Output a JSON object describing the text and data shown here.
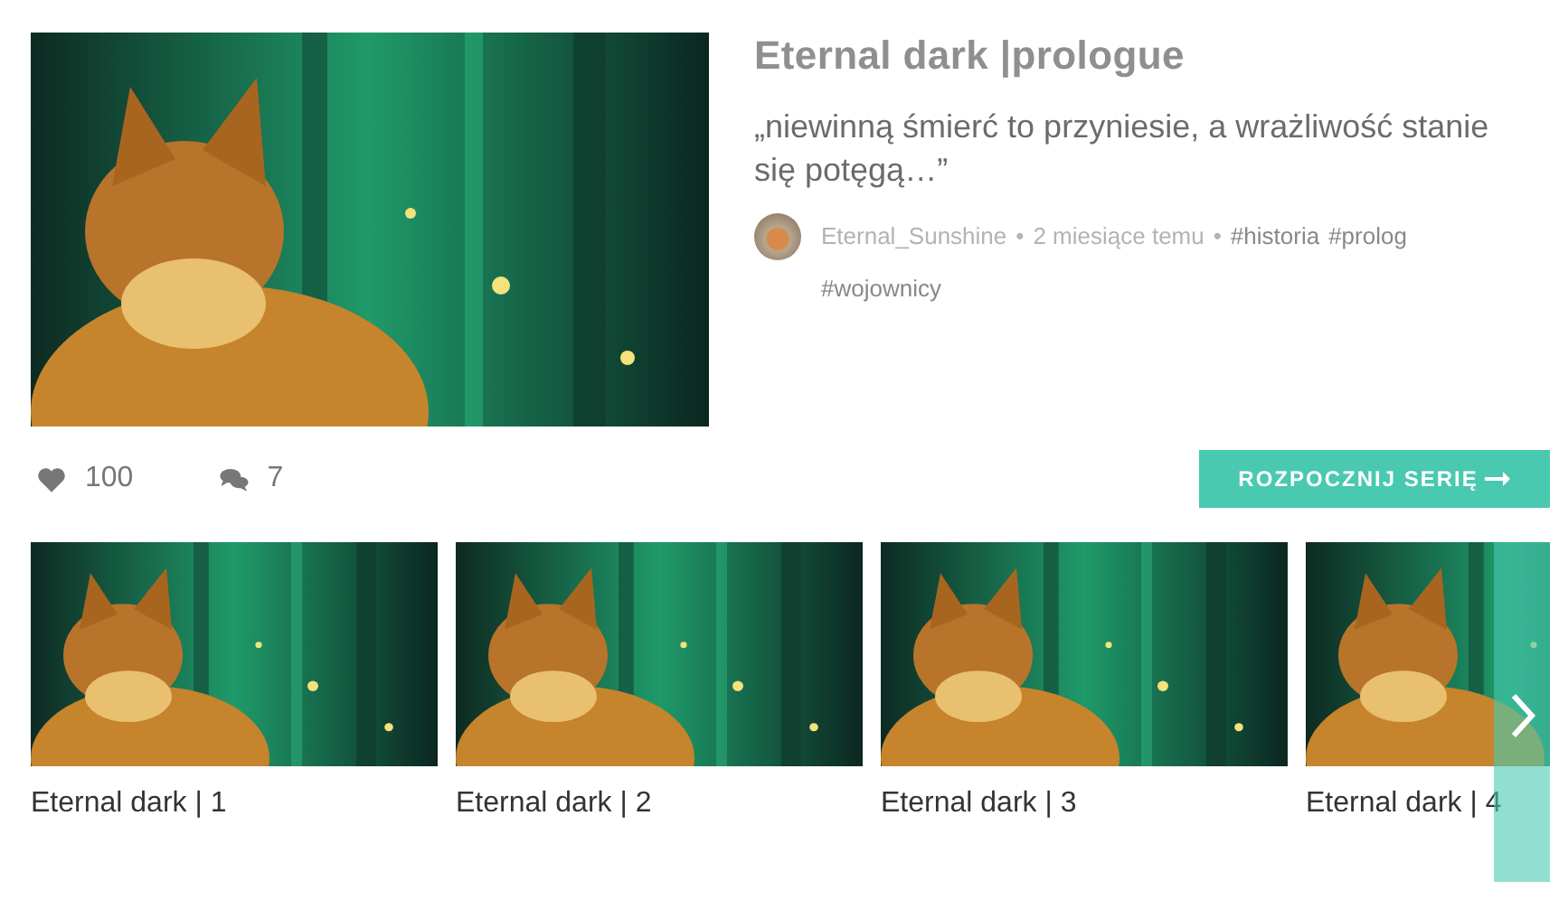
{
  "story": {
    "title": "Eternal dark |prologue",
    "excerpt": "„niewinną śmierć to przyniesie, a wrażliwość stanie się potęgą…”",
    "author": "Eternal_Sunshine",
    "time": "2 miesiące temu",
    "separator": "•",
    "tags": [
      "#historia",
      "#prolog",
      "#wojownicy"
    ]
  },
  "stats": {
    "likes": "100",
    "comments": "7"
  },
  "start_button": "ROZPOCZNIJ SERIĘ",
  "episodes": [
    {
      "title": "Eternal dark | 1"
    },
    {
      "title": "Eternal dark | 2"
    },
    {
      "title": "Eternal dark | 3"
    },
    {
      "title": "Eternal dark | 4"
    }
  ]
}
